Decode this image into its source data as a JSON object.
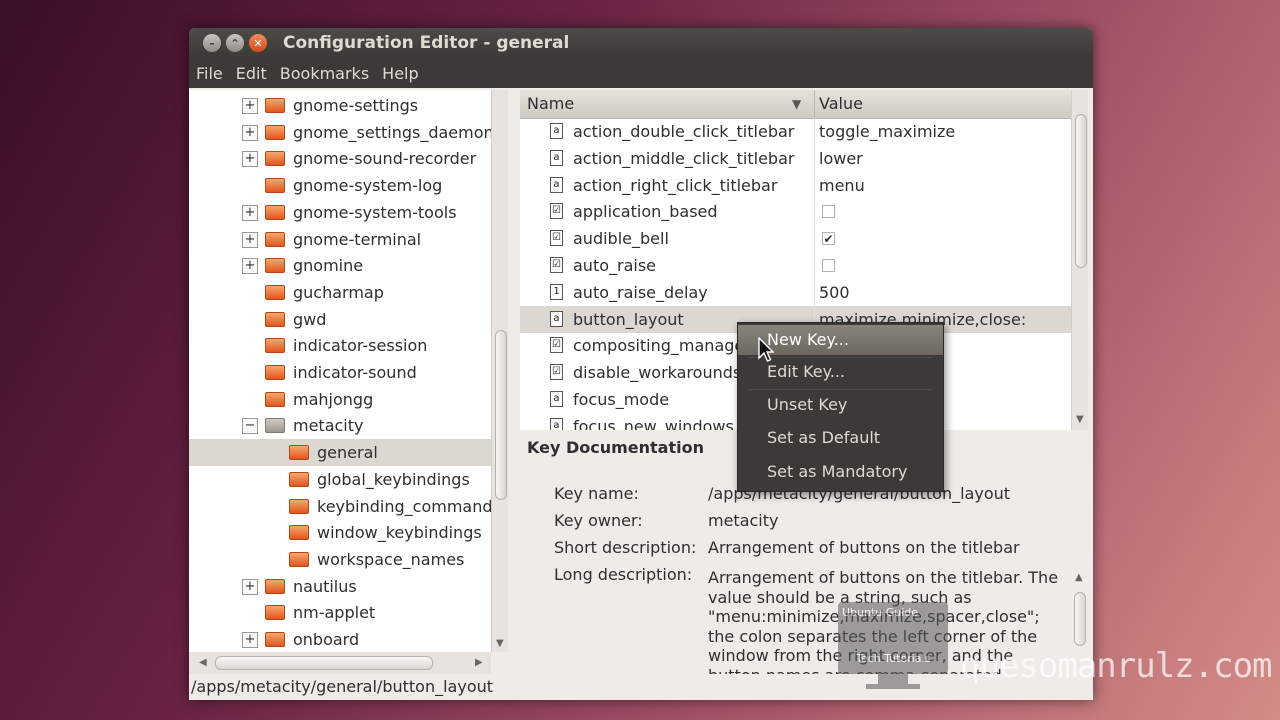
{
  "window": {
    "title": "Configuration Editor - general",
    "buttons": [
      "minimize",
      "maximize",
      "close"
    ]
  },
  "menu": {
    "items": [
      "File",
      "Edit",
      "Bookmarks",
      "Help"
    ]
  },
  "tree": {
    "items": [
      {
        "label": "gnome-settings",
        "expander": "+"
      },
      {
        "label": "gnome_settings_daemon",
        "expander": "+"
      },
      {
        "label": "gnome-sound-recorder",
        "expander": "+"
      },
      {
        "label": "gnome-system-log",
        "expander": ""
      },
      {
        "label": "gnome-system-tools",
        "expander": "+"
      },
      {
        "label": "gnome-terminal",
        "expander": "+"
      },
      {
        "label": "gnomine",
        "expander": "+"
      },
      {
        "label": "gucharmap",
        "expander": ""
      },
      {
        "label": "gwd",
        "expander": ""
      },
      {
        "label": "indicator-session",
        "expander": ""
      },
      {
        "label": "indicator-sound",
        "expander": ""
      },
      {
        "label": "mahjongg",
        "expander": ""
      },
      {
        "label": "metacity",
        "expander": "−"
      },
      {
        "label": "general",
        "expander": ""
      },
      {
        "label": "global_keybindings",
        "expander": ""
      },
      {
        "label": "keybinding_commands",
        "expander": ""
      },
      {
        "label": "window_keybindings",
        "expander": ""
      },
      {
        "label": "workspace_names",
        "expander": ""
      },
      {
        "label": "nautilus",
        "expander": "+"
      },
      {
        "label": "nm-applet",
        "expander": ""
      },
      {
        "label": "onboard",
        "expander": "+"
      }
    ]
  },
  "list": {
    "columns": {
      "name": "Name",
      "value": "Value",
      "sort_icon": "▼"
    },
    "rows": [
      {
        "name": "action_double_click_titlebar",
        "value": "toggle_maximize",
        "type_icon": "a"
      },
      {
        "name": "action_middle_click_titlebar",
        "value": "lower",
        "type_icon": "a"
      },
      {
        "name": "action_right_click_titlebar",
        "value": "menu",
        "type_icon": "a"
      },
      {
        "name": "application_based",
        "value": "",
        "type_icon": "☑",
        "checkbox": "unchecked"
      },
      {
        "name": "audible_bell",
        "value": "",
        "type_icon": "☑",
        "checkbox": "checked",
        "check_mark": "✔"
      },
      {
        "name": "auto_raise",
        "value": "",
        "type_icon": "☑",
        "checkbox": "unchecked"
      },
      {
        "name": "auto_raise_delay",
        "value": "500",
        "type_icon": "1"
      },
      {
        "name": "button_layout",
        "value": "maximize,minimize,close:",
        "type_icon": "a"
      },
      {
        "name": "compositing_manager",
        "value": "",
        "type_icon": "☑"
      },
      {
        "name": "disable_workarounds",
        "value": "",
        "type_icon": "☑"
      },
      {
        "name": "focus_mode",
        "value": "",
        "type_icon": "a"
      },
      {
        "name": "focus_new_windows",
        "value": "",
        "type_icon": "a"
      }
    ]
  },
  "context_menu": {
    "items": [
      "New Key...",
      "Edit Key...",
      "Unset Key",
      "Set as Default",
      "Set as Mandatory"
    ]
  },
  "docs": {
    "title": "Key Documentation",
    "key_name_label": "Key name:",
    "key_name": "/apps/metacity/general/button_layout",
    "key_owner_label": "Key owner:",
    "key_owner": "metacity",
    "short_desc_label": "Short description:",
    "short_desc": "Arrangement of buttons on the titlebar",
    "long_desc_label": "Long description:",
    "long_desc": "Arrangement of buttons on the titlebar. The value should be a string, such as \"menu:minimize,maximize,spacer,close\"; the colon separates the left corner of the window from the right corner, and the button names are comma-separated."
  },
  "status": {
    "path": "/apps/metacity/general/button_layout"
  },
  "overlay": {
    "line1": "Ubuntu Guide",
    "line2": "Tech Tutorials",
    "watermark": "quesomanrulz.com"
  }
}
